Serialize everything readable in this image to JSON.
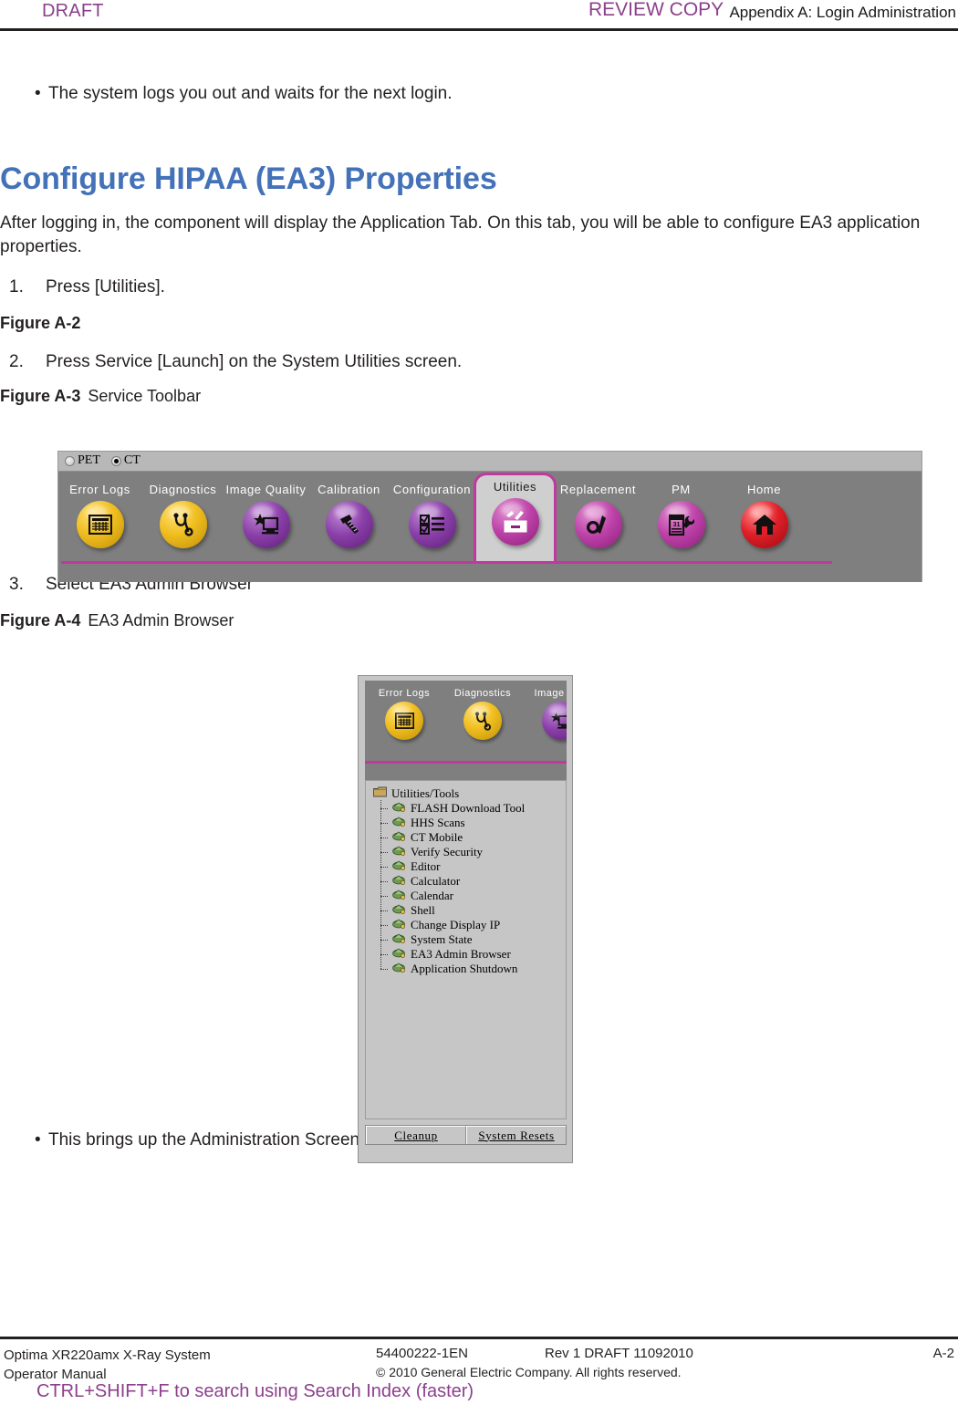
{
  "header": {
    "draft_watermark": "DRAFT",
    "chapter": "Appendix A: Login Administration",
    "review_watermark": "REVIEW COPY"
  },
  "body": {
    "intro_bullet": "The system logs you out and waits for the next login.",
    "section_title": "Configure HIPAA (EA3) Properties",
    "intro_paragraph": "After logging in, the component will display the Application Tab. On this tab, you will be able to configure EA3 application properties.",
    "step1_num": "1.",
    "step1_text": "Press [Utilities].",
    "figure_a2_label": "Figure A-2",
    "figure_a2_title": "",
    "step2_num": "2.",
    "step2_text": "Press Service [Launch] on the System Utilities screen.",
    "figure_a3_label": "Figure A-3",
    "figure_a3_title": "Service Toolbar",
    "step3_num": "3.",
    "step3_text": "Select EA3 Admin Browser",
    "figure_a4_label": "Figure A-4",
    "figure_a4_title": "EA3 Admin Browser",
    "closing_bullet": "This brings up the Administration Screen.",
    "bullet_glyph": "•"
  },
  "service_toolbar": {
    "modality_options": [
      {
        "label": "PET",
        "selected": false
      },
      {
        "label": "CT",
        "selected": true
      }
    ],
    "tabs": [
      {
        "label": "Error Logs",
        "icon": "grid-table-icon",
        "color": "gold",
        "selected": false
      },
      {
        "label": "Diagnostics",
        "icon": "stethoscope-icon",
        "color": "gold",
        "selected": false
      },
      {
        "label": "Image Quality",
        "icon": "star-monitor-icon",
        "color": "purple",
        "selected": false
      },
      {
        "label": "Calibration",
        "icon": "calibration-phantom-icon",
        "color": "purple",
        "selected": false
      },
      {
        "label": "Configuration",
        "icon": "checklist-icon",
        "color": "purple",
        "selected": false
      },
      {
        "label": "Utilities",
        "icon": "toolbox-icon",
        "color": "magenta",
        "selected": true
      },
      {
        "label": "Replacement",
        "icon": "part-swap-icon",
        "color": "magenta",
        "selected": false
      },
      {
        "label": "PM",
        "icon": "calendar-wrench-icon",
        "color": "magenta",
        "selected": false
      },
      {
        "label": "Home",
        "icon": "house-icon",
        "color": "red",
        "selected": false
      }
    ],
    "accent_color": "#c0399f"
  },
  "ea3_browser": {
    "tabs": [
      {
        "label": "Error Logs",
        "icon": "grid-table-icon",
        "color": "gold"
      },
      {
        "label": "Diagnostics",
        "icon": "stethoscope-icon",
        "color": "gold"
      },
      {
        "label": "Image Qua",
        "icon": "star-monitor-icon",
        "color": "purple"
      }
    ],
    "tree_root": {
      "label": "Utilities/Tools",
      "icon": "folder-icon"
    },
    "tree_items": [
      {
        "label": "FLASH Download Tool"
      },
      {
        "label": "HHS Scans"
      },
      {
        "label": "CT Mobile"
      },
      {
        "label": "Verify Security"
      },
      {
        "label": "Editor"
      },
      {
        "label": "Calculator"
      },
      {
        "label": "Calendar"
      },
      {
        "label": "Shell"
      },
      {
        "label": "Change Display IP"
      },
      {
        "label": "System State"
      },
      {
        "label": "EA3 Admin Browser"
      },
      {
        "label": "Application Shutdown"
      }
    ],
    "buttons": [
      {
        "label": "Cleanup"
      },
      {
        "label": "System Resets"
      }
    ]
  },
  "footer": {
    "product_line1": "Optima XR220amx X-Ray System",
    "product_line2": "Operator Manual",
    "doc_number": "54400222-1EN",
    "revision": "Rev 1 DRAFT 11092010",
    "copyright": "© 2010 General Electric Company. All rights reserved.",
    "page_number": "A-2",
    "search_hint": "CTRL+SHIFT+F to search using Search Index (faster)"
  }
}
